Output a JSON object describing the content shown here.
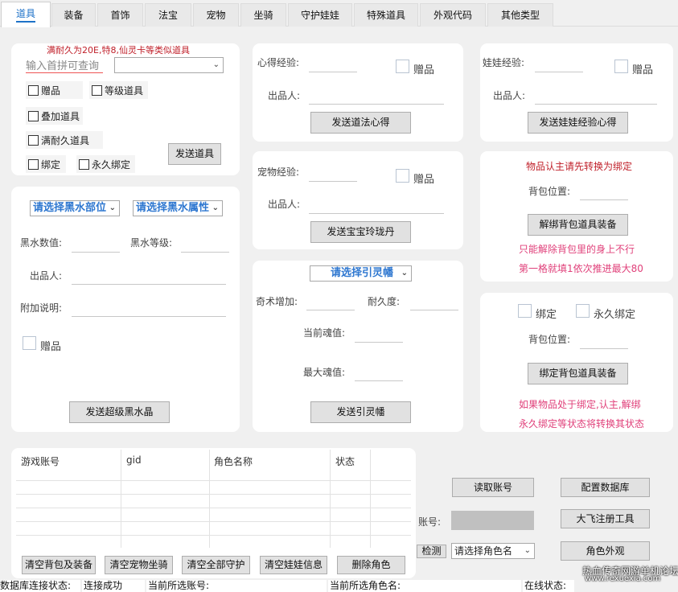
{
  "tabs": [
    "道具",
    "装备",
    "首饰",
    "法宝",
    "宠物",
    "坐骑",
    "守护娃娃",
    "特殊道具",
    "外观代码",
    "其他类型"
  ],
  "item_panel": {
    "notice": "满耐久为20E,特8,仙灵卡等类似道具",
    "search_placeholder": "输入首拼可查询",
    "gift": "赠品",
    "level_item": "等级道具",
    "stack_item": "叠加道具",
    "full_durability_item": "满耐久道具",
    "bind": "绑定",
    "permanent_bind": "永久绑定",
    "send": "发送道具"
  },
  "heart_panel": {
    "exp_label": "心得经验:",
    "gift": "赠品",
    "producer": "出品人:",
    "send": "发送道法心得"
  },
  "doll_panel": {
    "exp_label": "娃娃经验:",
    "gift": "赠品",
    "producer": "出品人:",
    "send": "发送娃娃经验心得"
  },
  "pet_panel": {
    "exp_label": "宠物经验:",
    "gift": "赠品",
    "producer": "出品人:",
    "send": "发送宝宝玲珑丹"
  },
  "unbind_panel": {
    "notice": "物品认主请先转换为绑定",
    "bag_pos": "背包位置:",
    "button": "解绑背包道具装备",
    "tip1": "只能解除背包里的身上不行",
    "tip2": "第一格就填1依次推进最大80"
  },
  "black_panel": {
    "select_part": "请选择黑水部位",
    "select_attr": "请选择黑水属性",
    "value": "黑水数值:",
    "level": "黑水等级:",
    "producer": "出品人:",
    "extra": "附加说明:",
    "gift": "赠品",
    "send": "发送超级黑水晶"
  },
  "banner_panel": {
    "select": "请选择引灵幡",
    "odd_bonus": "奇术增加:",
    "durability": "耐久度:",
    "cur_soul": "当前魂值:",
    "max_soul": "最大魂值:",
    "send": "发送引灵幡"
  },
  "bind_panel": {
    "bind": "绑定",
    "permanent_bind": "永久绑定",
    "bag_pos": "背包位置:",
    "button": "绑定背包道具装备",
    "tip1": "如果物品处于绑定,认主,解绑",
    "tip2": "永久绑定等状态将转换其状态"
  },
  "grid": {
    "columns": [
      "游戏账号",
      "gid",
      "角色名称",
      "状态"
    ]
  },
  "bottom_buttons": [
    "清空背包及装备",
    "清空宠物坐骑",
    "清空全部守护",
    "清空娃娃信息",
    "删除角色"
  ],
  "right_controls": {
    "read_account": "读取账号",
    "config_db": "配置数据库",
    "account_label": "账号:",
    "dafei_tool": "大飞注册工具",
    "check": "检测",
    "role_select": "请选择角色名",
    "role_look": "角色外观"
  },
  "status_bar": {
    "db_status_label": "数据库连接状态:",
    "db_status_value": "连接成功",
    "cur_account_label": "当前所选账号:",
    "cur_role_label": "当前所选角色名:",
    "online_label": "在线状态:"
  },
  "watermark": {
    "line1": "热血传奇网游单机论坛",
    "line2": "www.rexuexia.com"
  },
  "colors": {
    "accent_blue": "#1e72c8",
    "notice_red": "#c0202a",
    "tip_pink": "#e0407a"
  }
}
